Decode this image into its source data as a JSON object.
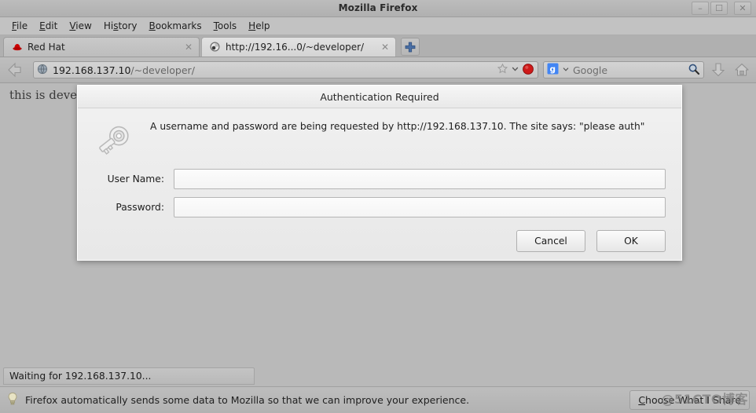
{
  "window": {
    "title": "Mozilla Firefox",
    "minimize_label": "–",
    "maximize_label": "❐",
    "close_label": "✕"
  },
  "menubar": {
    "items": [
      {
        "pre": "F",
        "rest": "ile"
      },
      {
        "pre": "E",
        "rest": "dit"
      },
      {
        "pre": "V",
        "rest": "iew"
      },
      {
        "pre": "Hi",
        "rest": "story",
        "accel_index": 2
      },
      {
        "pre": "B",
        "rest": "ookmarks"
      },
      {
        "pre": "T",
        "rest": "ools"
      },
      {
        "pre": "H",
        "rest": "elp"
      }
    ],
    "labels": [
      "File",
      "Edit",
      "View",
      "History",
      "Bookmarks",
      "Tools",
      "Help"
    ]
  },
  "tabs": [
    {
      "label": "Red Hat",
      "favicon": "redhat-icon",
      "close_label": "✕",
      "active": false
    },
    {
      "label": "http://192.16...0/~developer/",
      "favicon": "loading-icon",
      "close_label": "✕",
      "active": true
    }
  ],
  "newtab": {
    "label": "+"
  },
  "navbar": {
    "back_tooltip": "Back",
    "url_host": "192.168.137.10",
    "url_path": "/~developer/",
    "bookmark_icon": "star-icon",
    "dropdown_icon": "chevron-down-icon",
    "stop_icon": "stop-icon",
    "search_engine": "Google",
    "search_engine_icon": "google-g-icon",
    "search_icon": "magnifier-icon",
    "download_icon": "download-arrow-icon",
    "home_icon": "home-icon"
  },
  "page": {
    "body_text": "this is developer's home"
  },
  "dialog": {
    "title": "Authentication Required",
    "icon": "key-icon",
    "message": "A username and password are being requested by http://192.168.137.10. The site says: \"please auth\"",
    "fields": [
      {
        "label": "User Name:",
        "value": "",
        "placeholder": "",
        "type": "text",
        "name": "username-field"
      },
      {
        "label": "Password:",
        "value": "",
        "placeholder": "",
        "type": "password",
        "name": "password-field"
      }
    ],
    "cancel_label": "Cancel",
    "ok_label": "OK"
  },
  "statusbar": {
    "text": "Waiting for 192.168.137.10..."
  },
  "notification": {
    "icon": "lightbulb-icon",
    "text": "Firefox automatically sends some data to Mozilla so that we can improve your experience.",
    "button_pre": "C",
    "button_rest": "hoose What I Share",
    "button_label": "Choose What I Share"
  },
  "watermark": {
    "text": "@51CTO博客"
  }
}
